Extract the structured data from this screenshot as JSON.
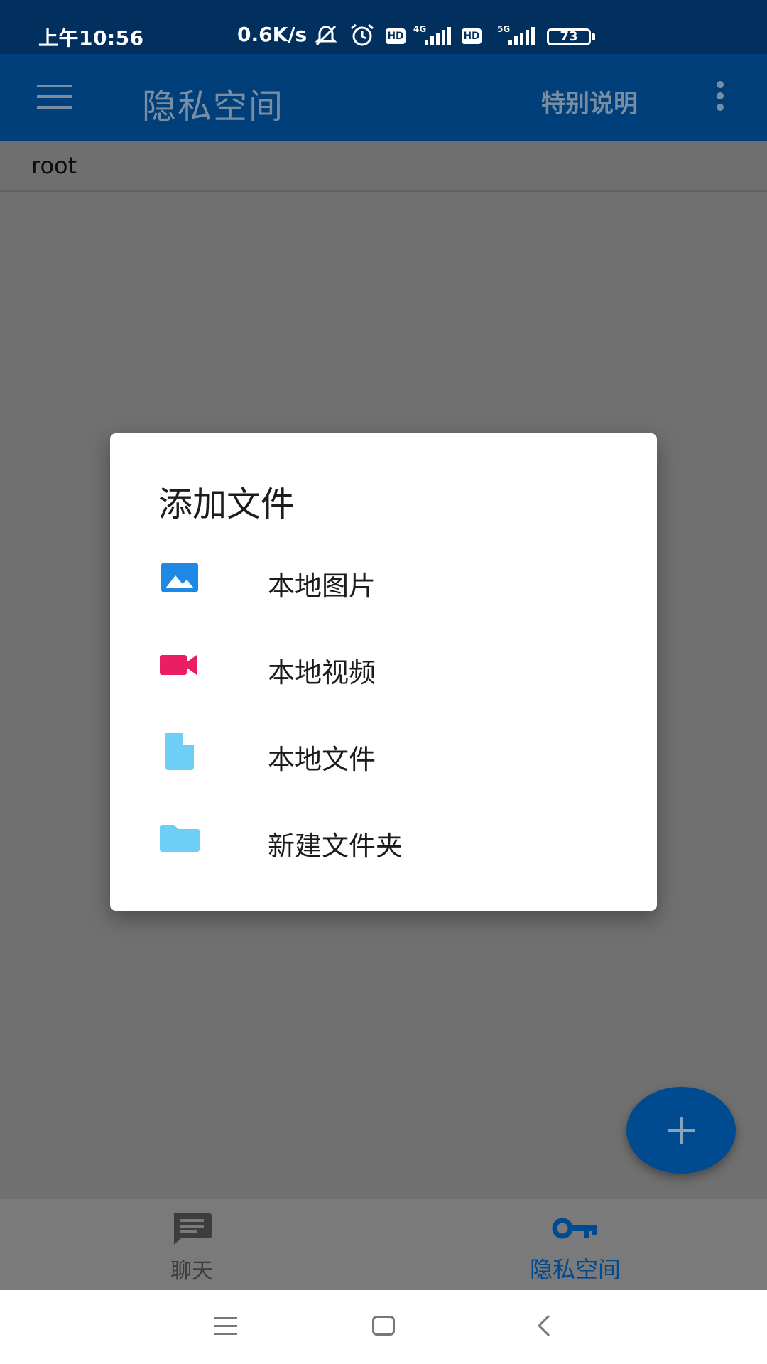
{
  "status_bar": {
    "time": "上午10:56",
    "net_speed": "0.6K/s",
    "hd_label": "HD",
    "network_4g": "4G",
    "network_5g": "5G",
    "battery": "73"
  },
  "app_bar": {
    "title": "隐私空间",
    "action_label": "特别说明"
  },
  "path": {
    "current": "root"
  },
  "dialog": {
    "title": "添加文件",
    "options": [
      {
        "label": "本地图片",
        "icon": "image-icon",
        "color": "#1e88e5"
      },
      {
        "label": "本地视频",
        "icon": "videocam-icon",
        "color": "#e91e63"
      },
      {
        "label": "本地文件",
        "icon": "file-icon",
        "color": "#6ecff6"
      },
      {
        "label": "新建文件夹",
        "icon": "folder-icon",
        "color": "#6ecff6"
      }
    ]
  },
  "bottom_nav": {
    "items": [
      {
        "label": "聊天",
        "icon": "chat-icon",
        "active": false
      },
      {
        "label": "隐私空间",
        "icon": "key-icon",
        "active": true
      }
    ]
  },
  "colors": {
    "primary": "#004a8f",
    "status_bar": "#02305e",
    "scrim": "#707070"
  }
}
